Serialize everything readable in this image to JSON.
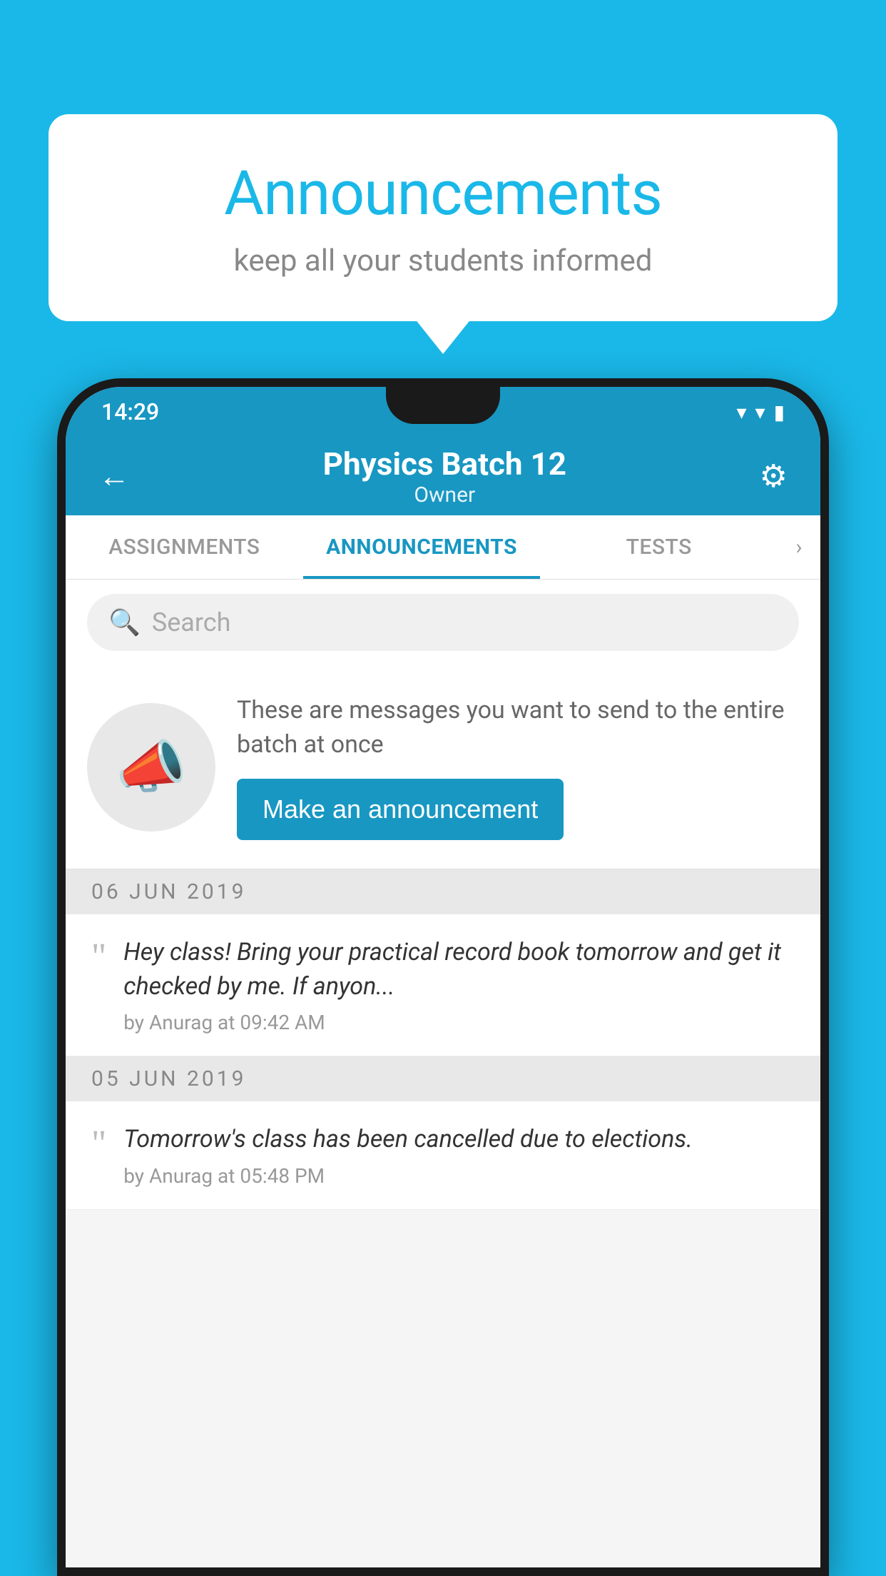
{
  "page": {
    "background_color": "#1AB8E8"
  },
  "speech_bubble": {
    "title": "Announcements",
    "subtitle": "keep all your students informed"
  },
  "status_bar": {
    "time": "14:29",
    "wifi": "▾",
    "signal": "▾",
    "battery": "▮"
  },
  "app_bar": {
    "back_label": "←",
    "title": "Physics Batch 12",
    "subtitle": "Owner",
    "settings_label": "⚙"
  },
  "tabs": [
    {
      "label": "ASSIGNMENTS",
      "active": false
    },
    {
      "label": "ANNOUNCEMENTS",
      "active": true
    },
    {
      "label": "TESTS",
      "active": false
    }
  ],
  "search": {
    "placeholder": "Search"
  },
  "promo": {
    "description": "These are messages you want to send to the entire batch at once",
    "button_label": "Make an announcement"
  },
  "announcements": [
    {
      "date": "06  JUN  2019",
      "text": "Hey class! Bring your practical record book tomorrow and get it checked by me. If anyon...",
      "meta": "by Anurag at 09:42 AM"
    },
    {
      "date": "05  JUN  2019",
      "text": "Tomorrow's class has been cancelled due to elections.",
      "meta": "by Anurag at 05:48 PM"
    }
  ]
}
